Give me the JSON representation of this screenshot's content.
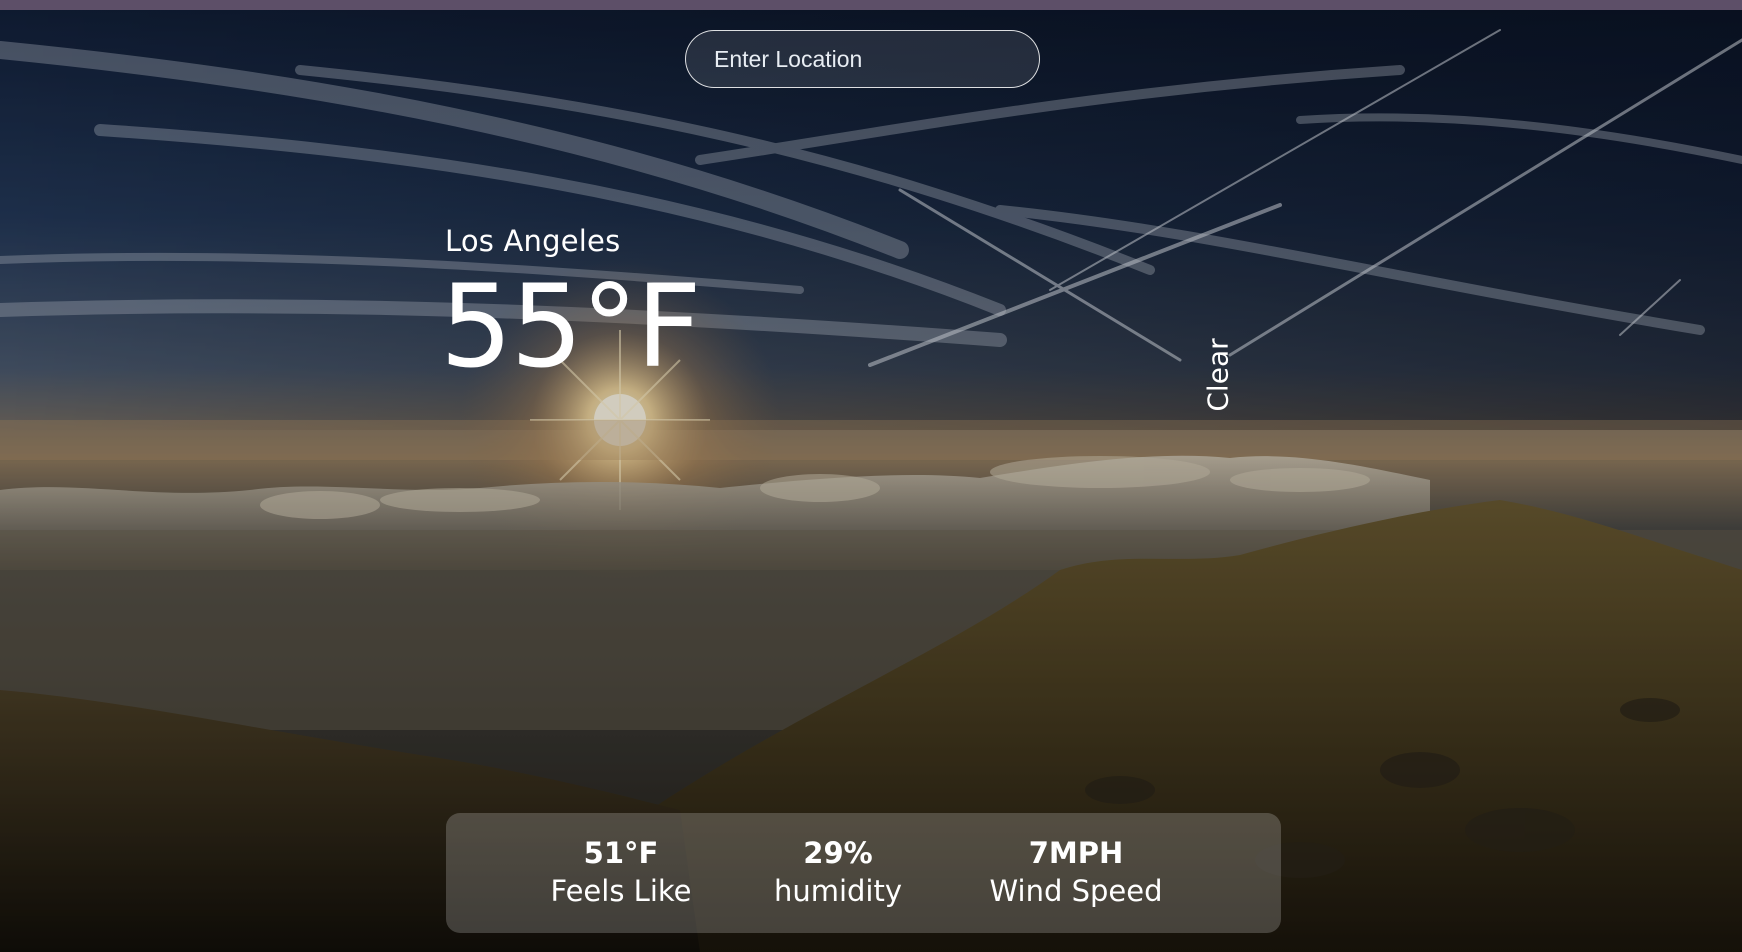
{
  "search": {
    "placeholder": "Enter Location",
    "value": ""
  },
  "current": {
    "location": "Los Angeles",
    "temperature": "55°F",
    "condition": "Clear"
  },
  "details": {
    "feels_like_value": "51°F",
    "feels_like_label": "Feels Like",
    "humidity_value": "29%",
    "humidity_label": "humidity",
    "wind_value": "7MPH",
    "wind_label": "Wind Speed"
  },
  "colors": {
    "top_bar": "#5d4f68",
    "text": "#ffffff",
    "panel_tint": "rgba(255,255,255,0.20)"
  }
}
